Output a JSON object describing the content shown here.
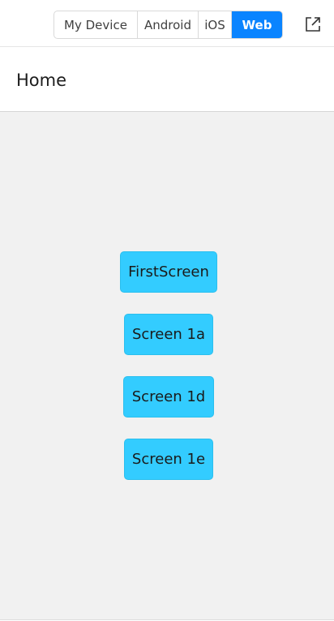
{
  "platform_switcher": {
    "options": [
      "My Device",
      "Android",
      "iOS",
      "Web"
    ],
    "selected": "Web"
  },
  "toolbar": {
    "external_link_icon": "external-link-icon"
  },
  "header": {
    "title": "Home"
  },
  "main": {
    "buttons": [
      "FirstScreen",
      "Screen 1a",
      "Screen 1d",
      "Screen 1e"
    ]
  },
  "colors": {
    "accent": "#0a84ff",
    "button_bg": "#33ccff",
    "content_bg": "#f1f1f1"
  }
}
